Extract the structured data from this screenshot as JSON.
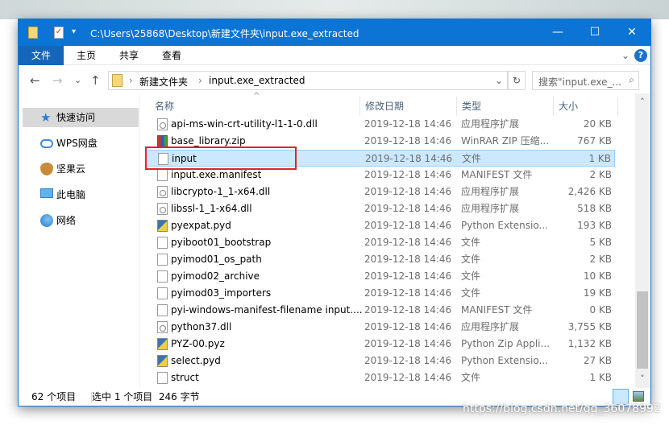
{
  "window": {
    "title": "C:\\Users\\25868\\Desktop\\新建文件夹\\input.exe_extracted",
    "min": "—",
    "max": "☐",
    "close": "✕"
  },
  "ribbon": {
    "tabs": [
      "文件",
      "主页",
      "共享",
      "查看"
    ],
    "expand": "⌄",
    "help": "?"
  },
  "nav": {
    "back": "←",
    "forward": "→",
    "recent": "⌄",
    "up": "↑",
    "breadcrumb": [
      "新建文件夹",
      "input.exe_extracted"
    ],
    "sep": "›",
    "dropdown": "⌄",
    "refresh": "↻",
    "search_placeholder": "搜索\"input.exe_...",
    "search_icon": "⌕"
  },
  "sidebar": {
    "items": [
      {
        "label": "快速访问",
        "icon": "star-icon"
      },
      {
        "label": "WPS网盘",
        "icon": "cloud-icon"
      },
      {
        "label": "坚果云",
        "icon": "nut-icon"
      },
      {
        "label": "此电脑",
        "icon": "computer-icon"
      },
      {
        "label": "网络",
        "icon": "network-icon"
      }
    ]
  },
  "columns": {
    "name": "名称",
    "date": "修改日期",
    "type": "类型",
    "size": "大小",
    "sort_indicator": "^"
  },
  "files": [
    {
      "name": "api-ms-win-crt-utility-l1-1-0.dll",
      "date": "2019-12-18 14:46",
      "type": "应用程序扩展",
      "size": "20 KB",
      "icon": "dll"
    },
    {
      "name": "base_library.zip",
      "date": "2019-12-18 14:46",
      "type": "WinRAR ZIP 压缩...",
      "size": "767 KB",
      "icon": "zip"
    },
    {
      "name": "input",
      "date": "2019-12-18 14:46",
      "type": "文件",
      "size": "1 KB",
      "icon": "file",
      "selected": true
    },
    {
      "name": "input.exe.manifest",
      "date": "2019-12-18 14:46",
      "type": "MANIFEST 文件",
      "size": "2 KB",
      "icon": "file"
    },
    {
      "name": "libcrypto-1_1-x64.dll",
      "date": "2019-12-18 14:46",
      "type": "应用程序扩展",
      "size": "2,426 KB",
      "icon": "dll"
    },
    {
      "name": "libssl-1_1-x64.dll",
      "date": "2019-12-18 14:46",
      "type": "应用程序扩展",
      "size": "518 KB",
      "icon": "dll"
    },
    {
      "name": "pyexpat.pyd",
      "date": "2019-12-18 14:46",
      "type": "Python Extensio...",
      "size": "193 KB",
      "icon": "py"
    },
    {
      "name": "pyiboot01_bootstrap",
      "date": "2019-12-18 14:46",
      "type": "文件",
      "size": "5 KB",
      "icon": "file"
    },
    {
      "name": "pyimod01_os_path",
      "date": "2019-12-18 14:46",
      "type": "文件",
      "size": "2 KB",
      "icon": "file"
    },
    {
      "name": "pyimod02_archive",
      "date": "2019-12-18 14:46",
      "type": "文件",
      "size": "10 KB",
      "icon": "file"
    },
    {
      "name": "pyimod03_importers",
      "date": "2019-12-18 14:46",
      "type": "文件",
      "size": "19 KB",
      "icon": "file"
    },
    {
      "name": "pyi-windows-manifest-filename input....",
      "date": "2019-12-18 14:46",
      "type": "MANIFEST 文件",
      "size": "0 KB",
      "icon": "file"
    },
    {
      "name": "python37.dll",
      "date": "2019-12-18 14:46",
      "type": "应用程序扩展",
      "size": "3,755 KB",
      "icon": "dll"
    },
    {
      "name": "PYZ-00.pyz",
      "date": "2019-12-18 14:46",
      "type": "Python Zip Appli...",
      "size": "1,132 KB",
      "icon": "py"
    },
    {
      "name": "select.pyd",
      "date": "2019-12-18 14:46",
      "type": "Python Extensio...",
      "size": "27 KB",
      "icon": "py"
    },
    {
      "name": "struct",
      "date": "2019-12-18 14:46",
      "type": "文件",
      "size": "1 KB",
      "icon": "file"
    }
  ],
  "scrollbar": {
    "up": "˄",
    "down": "˅"
  },
  "status": {
    "count": "62 个项目",
    "selected": "选中 1 个项目  246 字节"
  },
  "watermark": "https://blog.csdn.net/qq_36078992"
}
